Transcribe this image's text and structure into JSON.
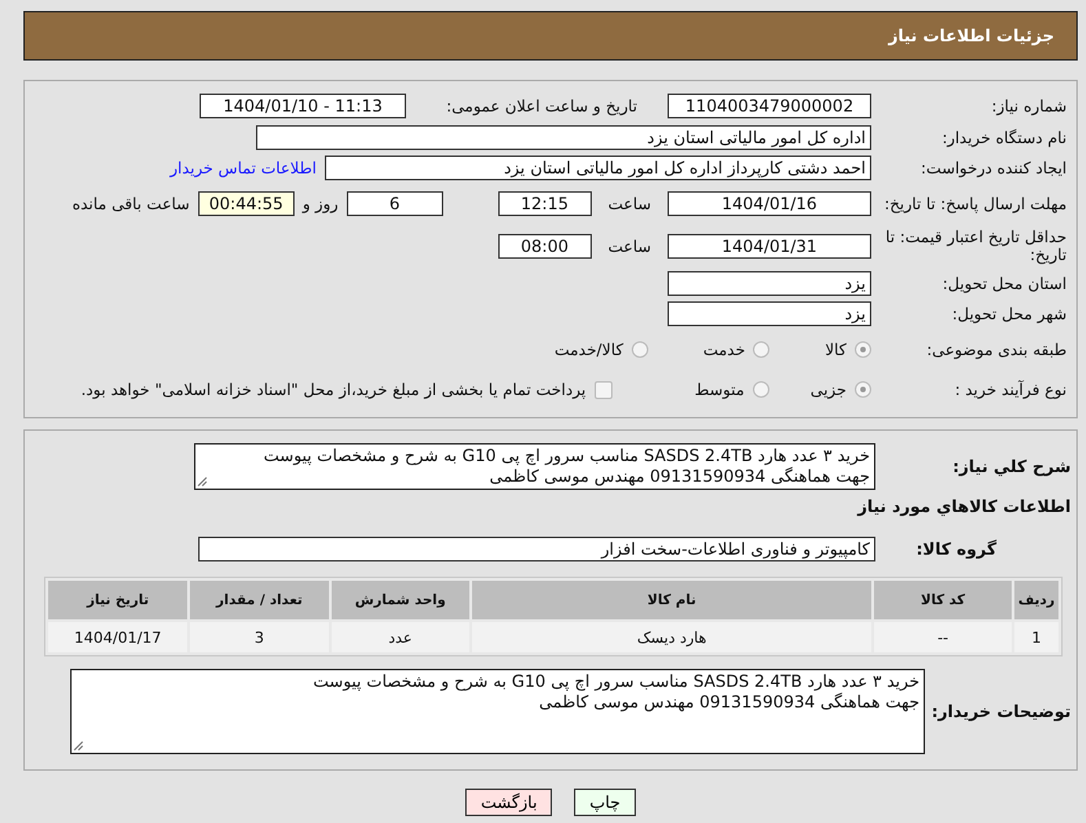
{
  "page_title": "جزئیات اطلاعات نیاز",
  "need_info": {
    "need_number": {
      "label": "شماره نیاز:",
      "value": "1104003479000002"
    },
    "announce": {
      "label": "تاریخ و ساعت اعلان عمومی:",
      "value": "1404/01/10 - 11:13"
    },
    "buyer_org": {
      "label": "نام دستگاه خریدار:",
      "value": "اداره کل امور مالیاتی استان یزد"
    },
    "requester": {
      "label": "ایجاد کننده درخواست:",
      "value": "احمد دشتی کارپرداز اداره کل امور مالیاتی استان یزد",
      "link": "اطلاعات تماس خریدار"
    },
    "deadline": {
      "label": "مهلت ارسال پاسخ: تا تاریخ:",
      "date": "1404/01/16",
      "time_label": "ساعت",
      "time": "12:15",
      "days": "6",
      "days_label": "روز و",
      "remaining": "00:44:55",
      "remaining_label": "ساعت باقی مانده"
    },
    "validity": {
      "label": "حداقل تاریخ اعتبار قیمت: تا تاریخ:",
      "date": "1404/01/31",
      "time_label": "ساعت",
      "time": "08:00"
    },
    "province": {
      "label": "استان محل تحویل:",
      "value": "یزد"
    },
    "city": {
      "label": "شهر محل تحویل:",
      "value": "یزد"
    },
    "category": {
      "label": "طبقه بندی موضوعی:",
      "options": [
        {
          "label": "کالا",
          "selected": true
        },
        {
          "label": "خدمت",
          "selected": false
        },
        {
          "label": "کالا/خدمت",
          "selected": false
        }
      ]
    },
    "process": {
      "label": "نوع فرآیند خرید :",
      "options": [
        {
          "label": "جزیی",
          "selected": true
        },
        {
          "label": "متوسط",
          "selected": false
        }
      ],
      "payment": {
        "checked": false,
        "text": "پرداخت تمام یا بخشی از مبلغ خرید،از محل \"اسناد خزانه اسلامی\" خواهد بود."
      }
    }
  },
  "description": {
    "label": "شرح کلي نياز:",
    "value": "خرید ۳ عدد هارد SASDS 2.4TB مناسب سرور اچ پی G10 به شرح و مشخصات پیوست\nجهت هماهنگی 09131590934 مهندس موسی کاظمی"
  },
  "goods_heading": "اطلاعات کالاهاي مورد نياز",
  "goods_group": {
    "label": "گروه کالا:",
    "value": "کامپیوتر و فناوری اطلاعات-سخت افزار"
  },
  "table": {
    "columns": [
      "ردیف",
      "کد کالا",
      "نام کالا",
      "واحد شمارش",
      "تعداد / مقدار",
      "تاریخ نیاز"
    ],
    "rows": [
      [
        "1",
        "--",
        "هارد دیسک",
        "عدد",
        "3",
        "1404/01/17"
      ]
    ]
  },
  "buyer_notes": {
    "label": "توضیحات خریدار:",
    "value": "خرید ۳ عدد هارد SASDS 2.4TB مناسب سرور اچ پی G10 به شرح و مشخصات پیوست\nجهت هماهنگی 09131590934 مهندس موسی کاظمی"
  },
  "buttons": [
    {
      "label": "چاپ",
      "kind": "print"
    },
    {
      "label": "بازگشت",
      "kind": "back"
    }
  ]
}
